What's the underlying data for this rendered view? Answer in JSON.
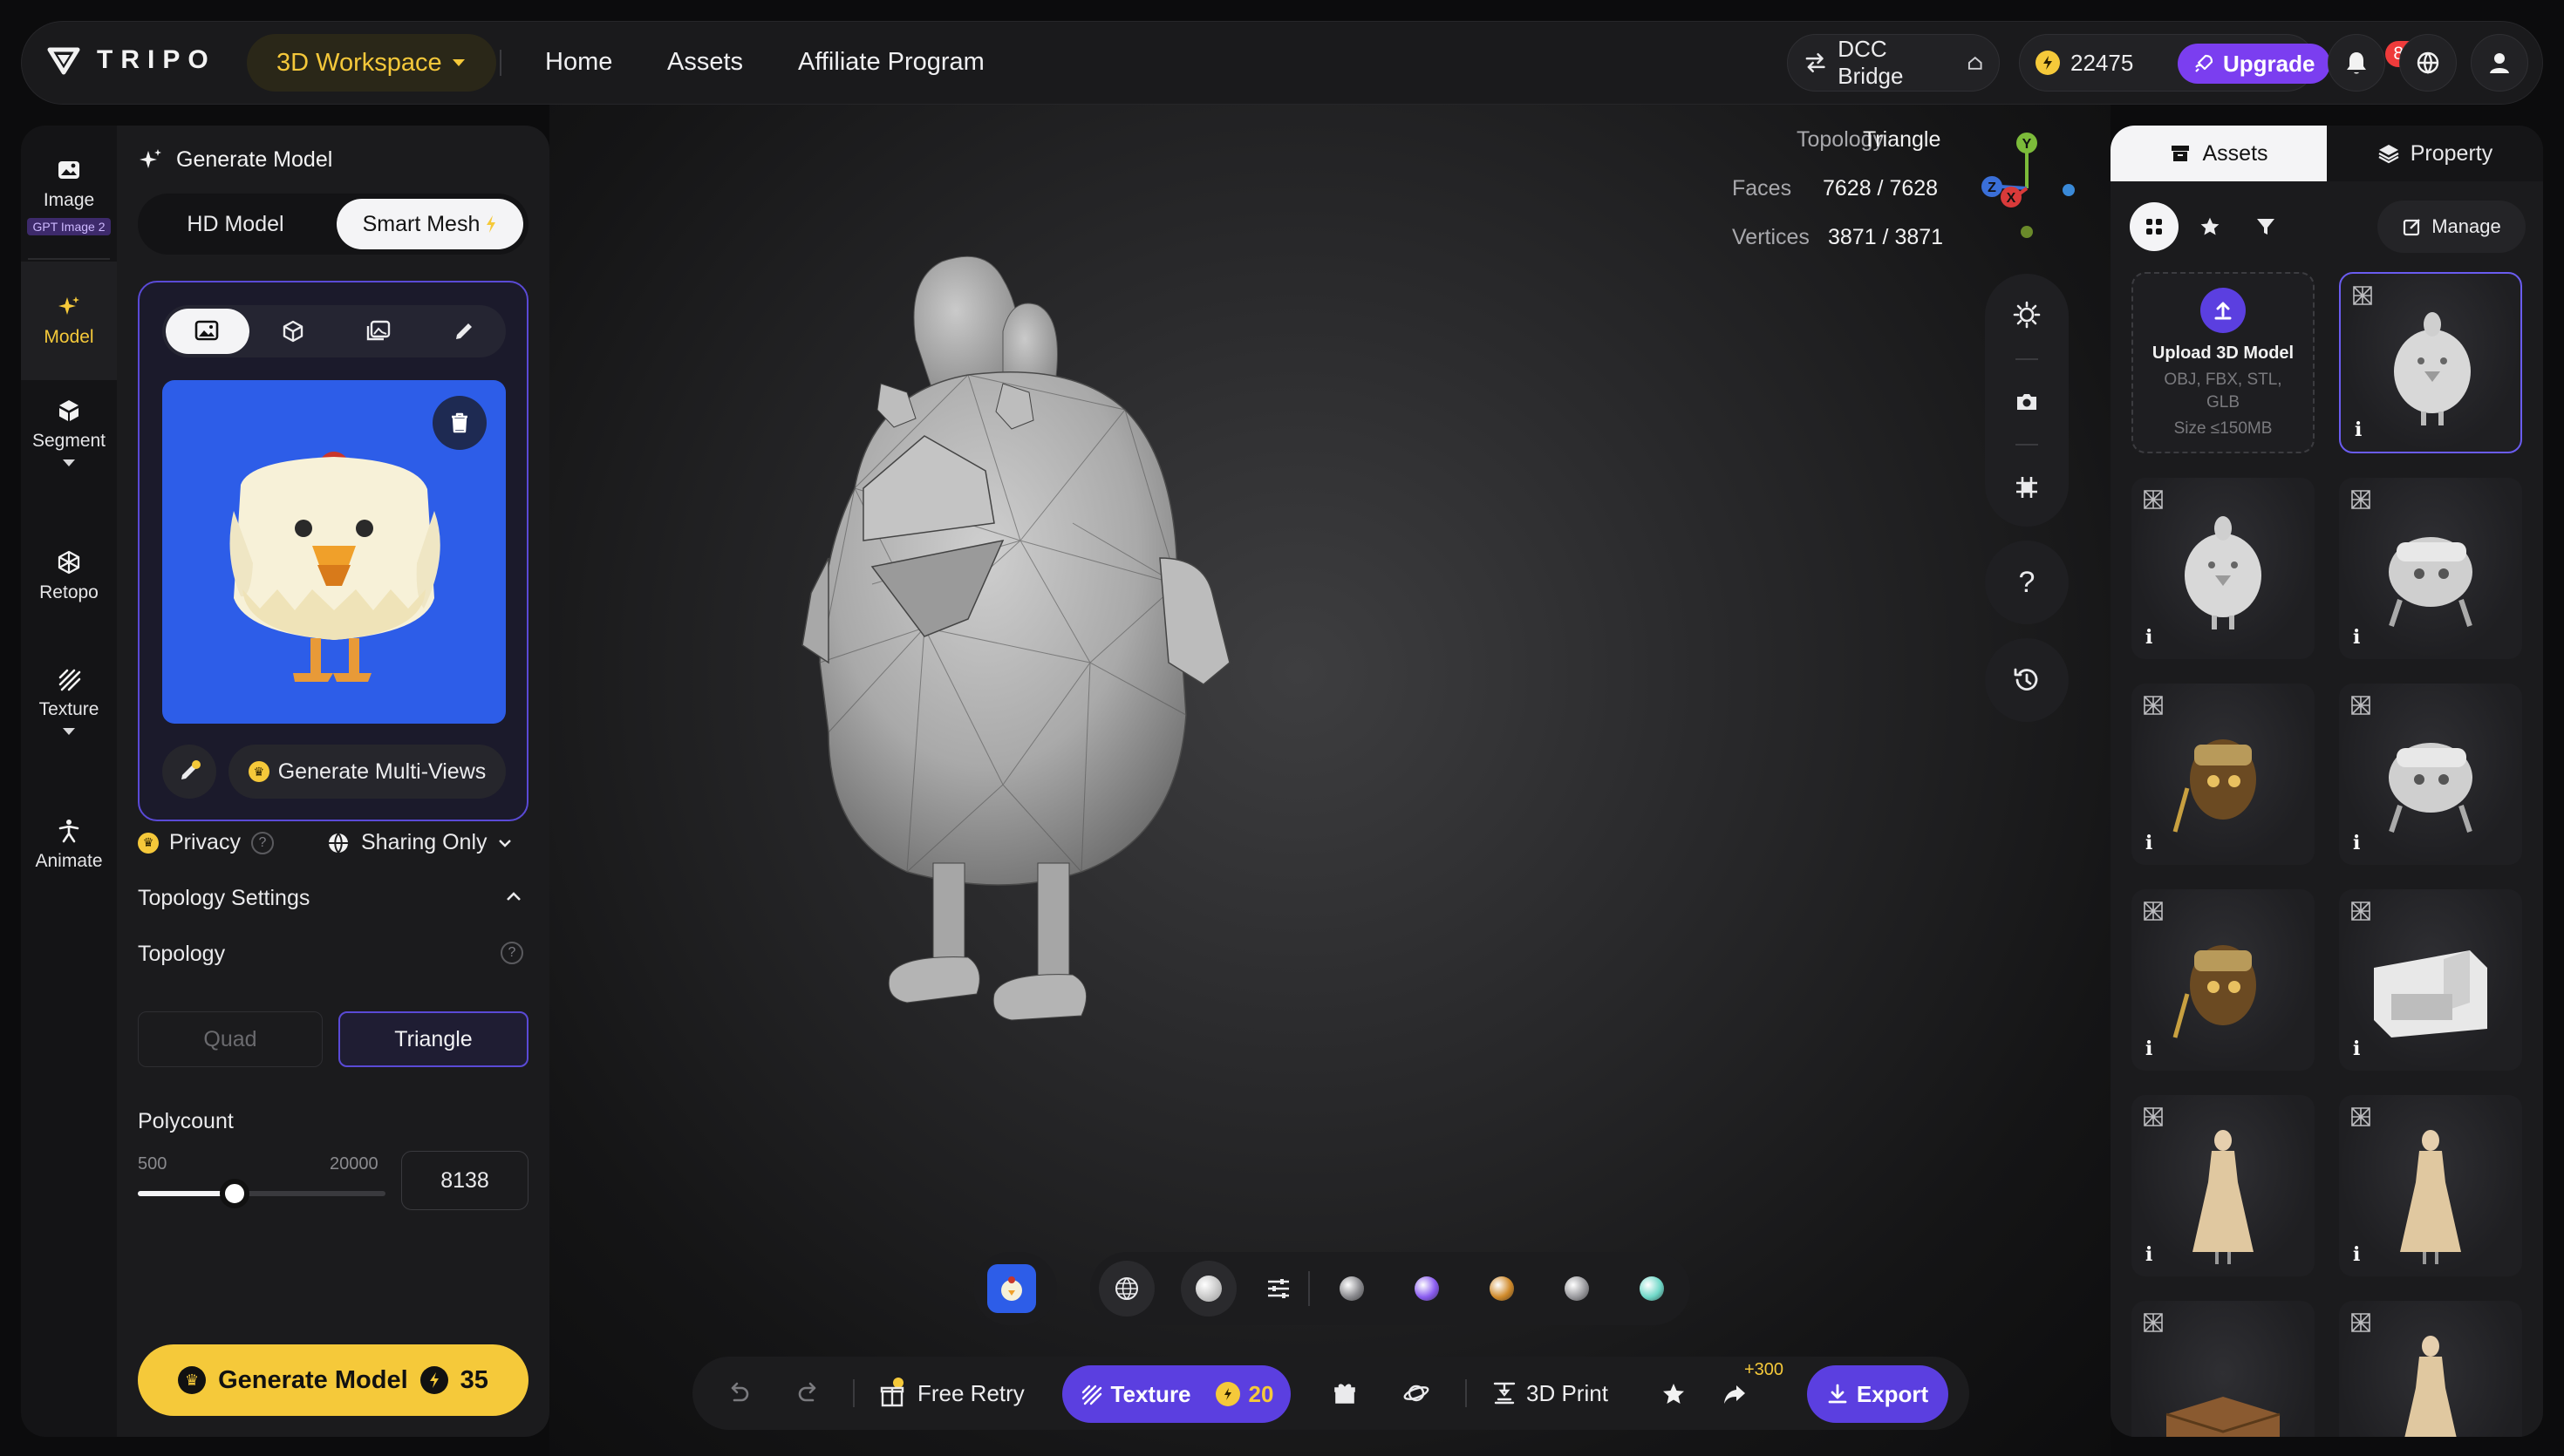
{
  "brand": {
    "name": "TRIPO"
  },
  "topbar": {
    "workspace": "3D Workspace",
    "nav": [
      "Home",
      "Assets",
      "Affiliate Program"
    ],
    "dcc_bridge": "DCC Bridge",
    "credits": "22475",
    "upgrade": "Upgrade",
    "notifications": "88"
  },
  "rail": {
    "items": [
      {
        "label": "Image",
        "tag": "GPT Image 2",
        "icon": "image-icon"
      },
      {
        "label": "Model",
        "icon": "sparkle-icon"
      },
      {
        "label": "Segment",
        "icon": "cube-segment-icon"
      },
      {
        "label": "Retopo",
        "icon": "retopo-icon"
      },
      {
        "label": "Texture",
        "icon": "texture-icon"
      },
      {
        "label": "Animate",
        "icon": "figure-icon"
      }
    ]
  },
  "panel": {
    "title": "Generate Model",
    "mode_hd": "HD Model",
    "mode_smart": "Smart Mesh",
    "multi_views": "Generate Multi-Views",
    "privacy": "Privacy",
    "sharing": "Sharing Only",
    "topology_settings": "Topology Settings",
    "topology_label": "Topology",
    "quad": "Quad",
    "triangle": "Triangle",
    "polycount_label": "Polycount",
    "poly_min": "500",
    "poly_max": "20000",
    "poly_value": "8138",
    "poly_fraction": 0.39,
    "generate": "Generate Model",
    "generate_cost": "35"
  },
  "viewport": {
    "topology_k": "Topology",
    "topology_v": "Triangle",
    "faces_k": "Faces",
    "faces_v": "7628 / 7628",
    "vertices_k": "Vertices",
    "vertices_v": "3871 / 3871",
    "axes": {
      "y": "Y",
      "z": "Z",
      "x": "X"
    },
    "help": "?"
  },
  "bottombar": {
    "free_retry": "Free Retry",
    "texture": "Texture",
    "texture_cost": "20",
    "print": "3D Print",
    "bonus": "+300",
    "export": "Export"
  },
  "materials": [
    "#8a8a8e",
    "#8a5cf0",
    "#d08a2a",
    "#9a9a9e",
    "#6fd8c8"
  ],
  "rpanel": {
    "tab_assets": "Assets",
    "tab_property": "Property",
    "manage": "Manage",
    "upload_title": "Upload 3D Model",
    "upload_formats": "OBJ, FBX, STL, GLB",
    "upload_size": "Size ≤150MB",
    "info": "i"
  },
  "colors": {
    "accent": "#5b3fe0",
    "gold": "#f5c93a",
    "panel": "#1b1b1d"
  }
}
